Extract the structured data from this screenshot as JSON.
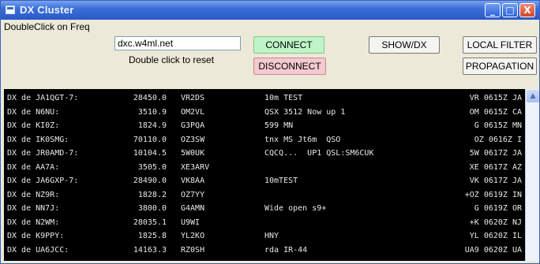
{
  "window": {
    "title": "DX Cluster",
    "controls": {
      "minimize": "_",
      "maximize": "□",
      "close": "X"
    }
  },
  "toolbar": {
    "freq_label": "DoubleClick on Freq",
    "server": "dxc.w4ml.net",
    "reset_hint": "Double click to reset",
    "connect_label": "CONNECT",
    "disconnect_label": "DISCONNECT",
    "show_dx_label": "SHOW/DX",
    "local_filter_label": "LOCAL FILTER",
    "propagation_label": "PROPAGATION"
  },
  "colors": {
    "connect_bg": "#bff5c6",
    "disconnect_bg": "#f4c9d1",
    "console_bg": "#000000",
    "console_fg": "#e8e8e8"
  },
  "spots": [
    {
      "spotter": "DX de JA1QGT-7:",
      "freq": "28450.0",
      "call": "VR2DS",
      "comment": "10m TEST",
      "tail": "VR 0615Z JA"
    },
    {
      "spotter": "DX de N6NU:",
      "freq": "3510.9",
      "call": "OM2VL",
      "comment": "QSX 3512 Now up 1",
      "tail": "OM 0615Z CA"
    },
    {
      "spotter": "DX de KI0Z:",
      "freq": "1824.9",
      "call": "G3PQA",
      "comment": "599 MN",
      "tail": "G 0615Z MN"
    },
    {
      "spotter": "DX de IK0SMG:",
      "freq": "70110.0",
      "call": "OZ3SW",
      "comment": "tnx MS Jt6m  QSO",
      "tail": "OZ 0616Z I"
    },
    {
      "spotter": "DX de JR0AMD-7:",
      "freq": "10104.5",
      "call": "5W0UK",
      "comment": "CQCQ...  UP1 QSL:SM6CUK",
      "tail": "5W 0617Z JA"
    },
    {
      "spotter": "DX de AA7A:",
      "freq": "3505.0",
      "call": "XE3ARV",
      "comment": "",
      "tail": "XE 0617Z AZ"
    },
    {
      "spotter": "DX de JA6GXP-7:",
      "freq": "28490.0",
      "call": "VK8AA",
      "comment": "10mTEST",
      "tail": "VK 0617Z JA"
    },
    {
      "spotter": "DX de NZ9R:",
      "freq": "1828.2",
      "call": "OZ7YY",
      "comment": "",
      "tail": "+OZ 0619Z IN"
    },
    {
      "spotter": "DX de NN7J:",
      "freq": "3800.0",
      "call": "G4AMN",
      "comment": "Wide open s9+",
      "tail": "G 0619Z OR"
    },
    {
      "spotter": "DX de N2WM:",
      "freq": "28035.1",
      "call": "U9WI",
      "comment": "",
      "tail": "+K 0620Z NJ"
    },
    {
      "spotter": "DX de K9PPY:",
      "freq": "1825.8",
      "call": "YL2KO",
      "comment": "HNY",
      "tail": "YL 0620Z IL"
    },
    {
      "spotter": "DX de UA6JCC:",
      "freq": "14163.3",
      "call": "RZ0SH",
      "comment": "rda IR-44",
      "tail": "UA9 0620Z UA"
    }
  ]
}
